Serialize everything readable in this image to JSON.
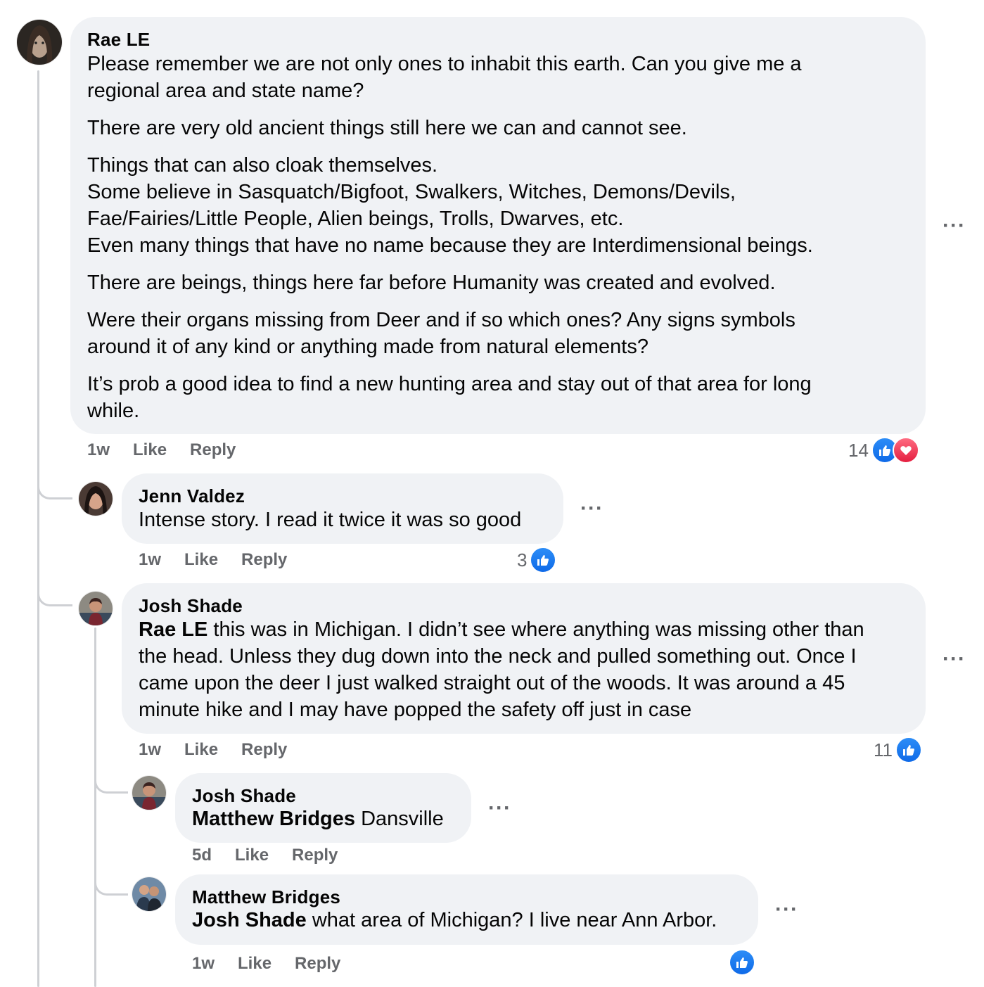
{
  "comments": [
    {
      "author": "Rae LE",
      "paragraphs": [
        [
          "Please remember we are not only ones to inhabit this earth. Can you give me a",
          "regional area and state name?"
        ],
        [
          "There are very old ancient things still here we can and cannot see."
        ],
        [
          "Things that can also cloak themselves.",
          "Some believe in Sasquatch/Bigfoot, Swalkers, Witches, Demons/Devils,",
          "Fae/Fairies/Little People, Alien beings, Trolls, Dwarves, etc.",
          "Even many things that have no name because they are Interdimensional beings."
        ],
        [
          "There are beings, things here far before Humanity was created and evolved."
        ],
        [
          "Were their organs missing from Deer and if so which ones? Any signs symbols",
          "around it of any kind or anything made from natural elements?"
        ],
        [
          "It’s prob a good idea to find a new hunting area and stay out of that area for long",
          "while."
        ]
      ],
      "time": "1w",
      "like_label": "Like",
      "reply_label": "Reply",
      "reaction_count": "14",
      "reactions": [
        "like-icon",
        "love-icon"
      ]
    },
    {
      "author": "Jenn Valdez",
      "lines": [
        "Intense story. I read it twice it was so good"
      ],
      "time": "1w",
      "like_label": "Like",
      "reply_label": "Reply",
      "reaction_count": "3",
      "reactions": [
        "like-icon"
      ]
    },
    {
      "author": "Josh Shade",
      "mention": "Rae LE",
      "lines": [
        " this was in Michigan. I didn’t see where anything was missing other than",
        "the head. Unless they dug down into the neck and pulled something out. Once I",
        "came upon the deer I just walked straight out of the woods. It was around a 45",
        "minute hike and I may have popped the safety off just in case"
      ],
      "time": "1w",
      "like_label": "Like",
      "reply_label": "Reply",
      "reaction_count": "11",
      "reactions": [
        "like-icon"
      ]
    },
    {
      "author": "Josh Shade",
      "mention": "Matthew Bridges",
      "text": " Dansville",
      "time": "5d",
      "like_label": "Like",
      "reply_label": "Reply"
    },
    {
      "author": "Matthew Bridges",
      "mention": "Josh Shade",
      "text": " what area of Michigan? I live near Ann Arbor.",
      "time": "1w",
      "like_label": "Like",
      "reply_label": "Reply",
      "reactions": [
        "like-icon"
      ]
    }
  ],
  "more_label": "···",
  "colors": {
    "bubble": "#f0f2f5",
    "like": "#1877f2",
    "love": "#e41e3f",
    "meta": "#65676b"
  }
}
